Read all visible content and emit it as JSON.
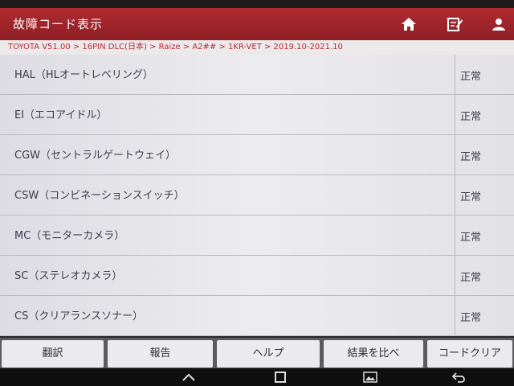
{
  "header": {
    "title": "故障コード表示",
    "icons": [
      "home-icon",
      "report-icon",
      "user-icon"
    ]
  },
  "breadcrumb": "TOYOTA V51.00 > 16PIN DLC(日本) > Raize > A2## > 1KR-VET > 2019.10-2021.10",
  "rows": [
    {
      "name": "HAL（HLオートレベリング）",
      "status": "正常"
    },
    {
      "name": "EI（エコアイドル）",
      "status": "正常"
    },
    {
      "name": "CGW（セントラルゲートウェイ）",
      "status": "正常"
    },
    {
      "name": "CSW（コンビネーションスイッチ）",
      "status": "正常"
    },
    {
      "name": "MC（モニターカメラ）",
      "status": "正常"
    },
    {
      "name": "SC（ステレオカメラ）",
      "status": "正常"
    },
    {
      "name": "CS（クリアランスソナー）",
      "status": "正常"
    }
  ],
  "toolbar": {
    "translate": "翻訳",
    "report": "報告",
    "help": "ヘルプ",
    "compare": "結果を比べ",
    "clear_codes": "コードクリア"
  },
  "colors": {
    "titlebar": "#9e242b",
    "breadcrumb_text": "#b52a30"
  }
}
